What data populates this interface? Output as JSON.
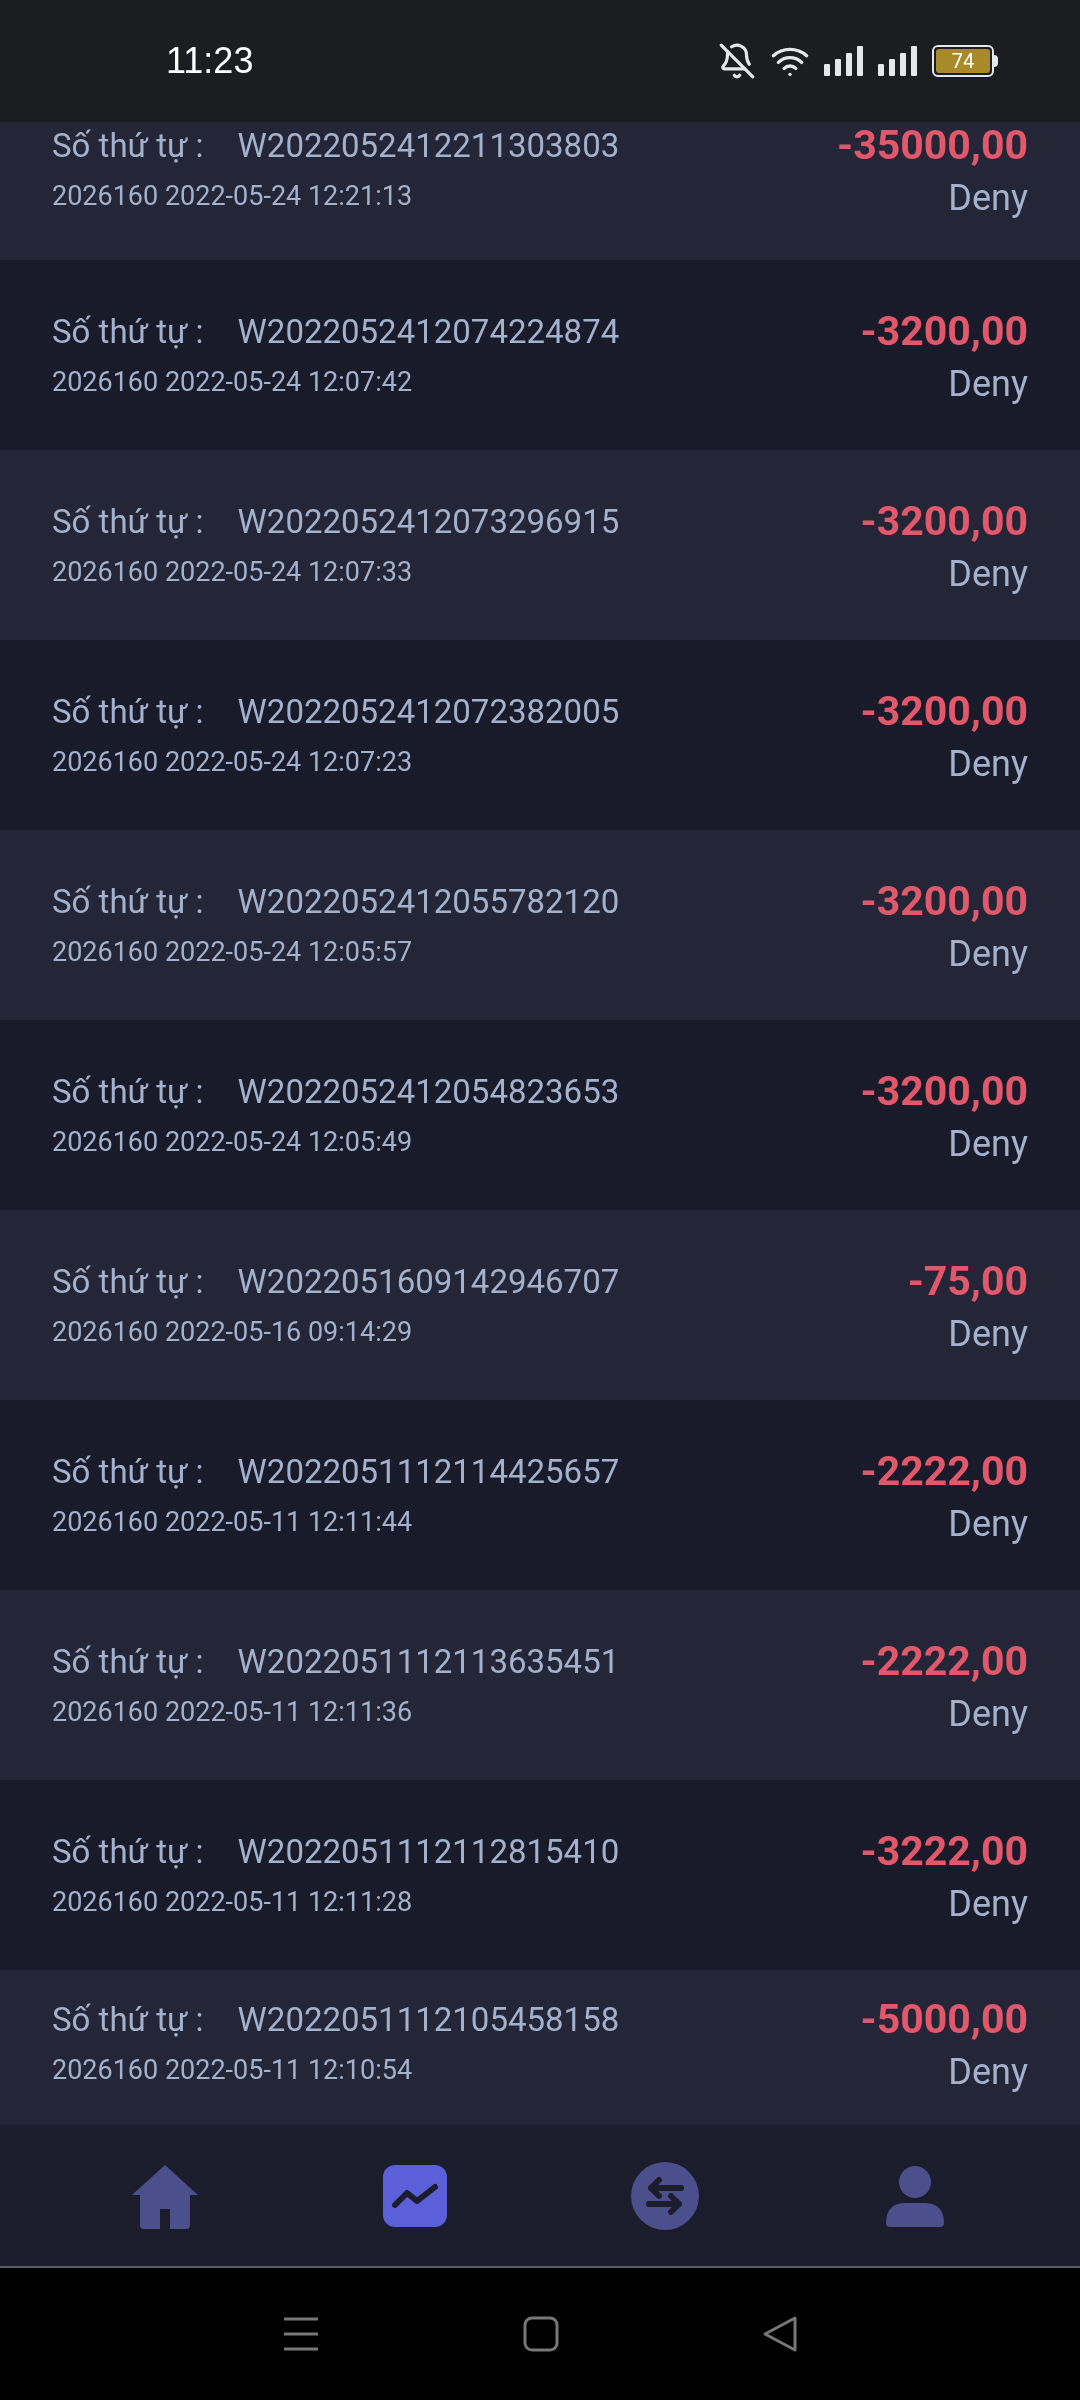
{
  "status_bar": {
    "time": "11:23",
    "battery": "74"
  },
  "transactions": [
    {
      "label": "Số thứ tự :",
      "order_no": "W2022052412211303803",
      "meta": "2026160 2022-05-24 12:21:13",
      "amount": "-35000,00",
      "status": "Deny"
    },
    {
      "label": "Số thứ tự :",
      "order_no": "W2022052412074224874",
      "meta": "2026160 2022-05-24 12:07:42",
      "amount": "-3200,00",
      "status": "Deny"
    },
    {
      "label": "Số thứ tự :",
      "order_no": "W2022052412073296915",
      "meta": "2026160 2022-05-24 12:07:33",
      "amount": "-3200,00",
      "status": "Deny"
    },
    {
      "label": "Số thứ tự :",
      "order_no": "W2022052412072382005",
      "meta": "2026160 2022-05-24 12:07:23",
      "amount": "-3200,00",
      "status": "Deny"
    },
    {
      "label": "Số thứ tự :",
      "order_no": "W2022052412055782120",
      "meta": "2026160 2022-05-24 12:05:57",
      "amount": "-3200,00",
      "status": "Deny"
    },
    {
      "label": "Số thứ tự :",
      "order_no": "W2022052412054823653",
      "meta": "2026160 2022-05-24 12:05:49",
      "amount": "-3200,00",
      "status": "Deny"
    },
    {
      "label": "Số thứ tự :",
      "order_no": "W2022051609142946707",
      "meta": "2026160 2022-05-16 09:14:29",
      "amount": "-75,00",
      "status": "Deny"
    },
    {
      "label": "Số thứ tự :",
      "order_no": "W2022051112114425657",
      "meta": "2026160 2022-05-11 12:11:44",
      "amount": "-2222,00",
      "status": "Deny"
    },
    {
      "label": "Số thứ tự :",
      "order_no": "W2022051112113635451",
      "meta": "2026160 2022-05-11 12:11:36",
      "amount": "-2222,00",
      "status": "Deny"
    },
    {
      "label": "Số thứ tự :",
      "order_no": "W2022051112112815410",
      "meta": "2026160 2022-05-11 12:11:28",
      "amount": "-3222,00",
      "status": "Deny"
    },
    {
      "label": "Số thứ tự :",
      "order_no": "W2022051112105458158",
      "meta": "2026160 2022-05-11 12:10:54",
      "amount": "-5000,00",
      "status": "Deny"
    }
  ],
  "bottom_nav": [
    {
      "kind": "home",
      "selected": false
    },
    {
      "kind": "chart",
      "selected": true
    },
    {
      "kind": "exchange",
      "selected": false
    },
    {
      "kind": "profile",
      "selected": false
    }
  ]
}
